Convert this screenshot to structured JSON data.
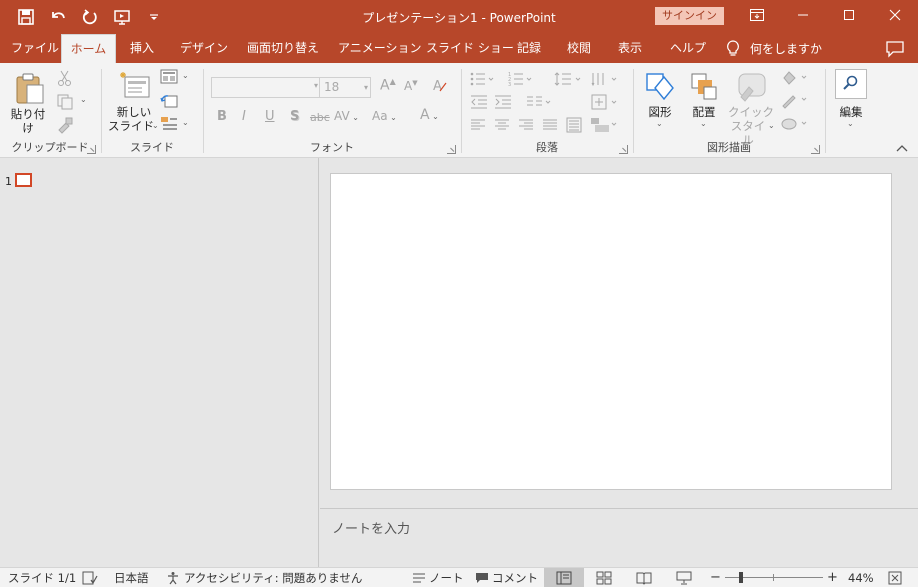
{
  "title_bar": {
    "title": "プレゼンテーション1  -  PowerPoint",
    "signin_label": "サインイン",
    "qat_icons": [
      "save-icon",
      "undo-icon",
      "redo-icon",
      "start-from-beginning-icon",
      "customize-qat-icon"
    ],
    "window_controls": [
      "ribbon-display-options-icon",
      "minimize-icon",
      "maximize-icon",
      "close-icon"
    ]
  },
  "tabs": [
    {
      "label": "ファイル",
      "active": false
    },
    {
      "label": "ホーム",
      "active": true
    },
    {
      "label": "挿入",
      "active": false
    },
    {
      "label": "デザイン",
      "active": false
    },
    {
      "label": "画面切り替え",
      "active": false
    },
    {
      "label": "アニメーション",
      "active": false
    },
    {
      "label": "スライド ショー",
      "active": false
    },
    {
      "label": "記録",
      "active": false
    },
    {
      "label": "校閲",
      "active": false
    },
    {
      "label": "表示",
      "active": false
    },
    {
      "label": "ヘルプ",
      "active": false
    }
  ],
  "tell_me": "何をしますか",
  "ribbon": {
    "clipboard": {
      "group_label": "クリップボード",
      "paste_label": "貼り付け"
    },
    "slides": {
      "group_label": "スライド",
      "new_slide_line1": "新しい",
      "new_slide_line2": "スライド"
    },
    "font": {
      "group_label": "フォント",
      "font_name": "",
      "font_size": "18",
      "bold": "B",
      "italic": "I",
      "underline": "U",
      "shadow": "S",
      "strikethrough": "abc",
      "spacing": "AV",
      "change_case": "Aa",
      "font_color": "A",
      "grow": "A",
      "shrink": "A"
    },
    "paragraph": {
      "group_label": "段落"
    },
    "drawing": {
      "group_label": "図形描画",
      "shapes_label": "図形",
      "arrange_label": "配置",
      "quick_styles_line1": "クイック",
      "quick_styles_line2": "スタイル"
    },
    "editing": {
      "label": "編集"
    }
  },
  "thumbnails": [
    {
      "number": "1"
    }
  ],
  "notes_placeholder": "ノートを入力",
  "status": {
    "slide_info": "スライド 1/1",
    "language": "日本語",
    "accessibility": "アクセシビリティ: 問題ありません",
    "notes_label": "ノート",
    "comments_label": "コメント",
    "zoom_out": "−",
    "zoom_in": "+",
    "zoom_level": "44%",
    "zoom_fraction": 0.44
  },
  "colors": {
    "accent": "#b7472a",
    "thumb_border": "#d24726",
    "signin_bg": "#f4c6b7"
  }
}
